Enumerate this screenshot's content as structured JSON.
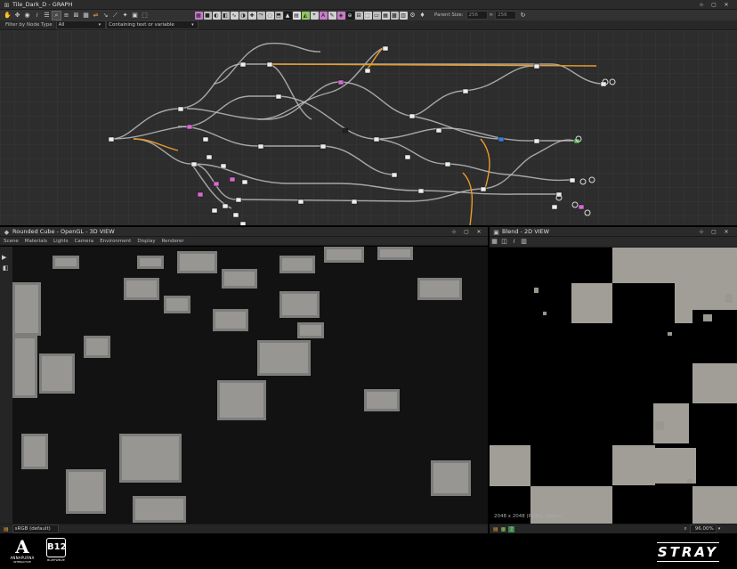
{
  "graph_panel": {
    "title": "Tile_Dark_D - GRAPH",
    "filter_label": "Filter by Node Type",
    "filter_value": "All",
    "search_mode": "Containing text or variable",
    "parent_size_label": "Parent Size:",
    "parent_size_w": "256",
    "parent_size_h": "256"
  },
  "view3d_panel": {
    "title": "Rounded Cube - OpenGL - 3D VIEW",
    "menu": [
      "Scene",
      "Materials",
      "Lights",
      "Camera",
      "Environment",
      "Display",
      "Renderer"
    ],
    "colorspace": "sRGB (default)"
  },
  "view2d_panel": {
    "title": "Blend - 2D VIEW",
    "image_info": "2048 x 2048 (RGBA, 16bpc)",
    "zoom": "96.00%"
  },
  "footer": {
    "logo_left_text": "ANNAPURNA",
    "logo_left_sub": "INTERACTIVE",
    "logo_mid_text": "B12",
    "logo_mid_sub": "BLUETWELVE",
    "logo_right_text": "STRAY"
  },
  "colors": {
    "panel_bg": "#2d2d2d",
    "titlebar_bg": "#2b2b2b",
    "link_wire": "#bcbcbc",
    "link_wire_active": "#e89c2c",
    "selection_blue": "#3a7fd4"
  }
}
